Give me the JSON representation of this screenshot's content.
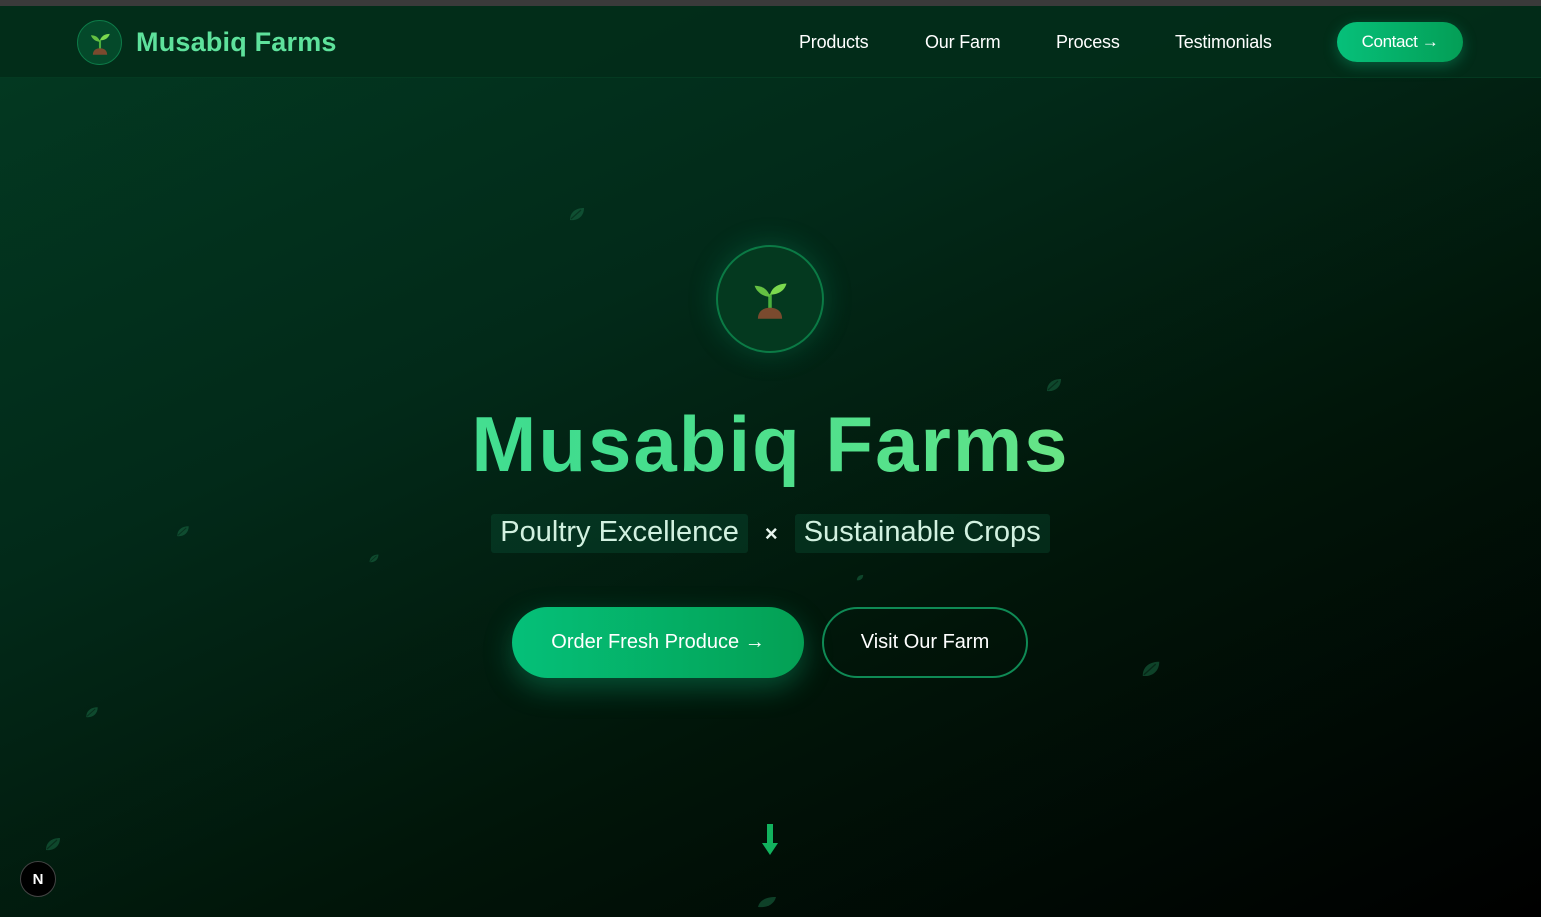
{
  "nav": {
    "brand_name": "Musabiq Farms",
    "logo_icon": "seedling-icon",
    "links": [
      "Products",
      "Our Farm",
      "Process",
      "Testimonials"
    ],
    "contact_label": "Contact →"
  },
  "hero": {
    "icon": "seedling-icon",
    "title": "Musabiq Farms",
    "tag_left": "Poultry Excellence",
    "tag_separator": "×",
    "tag_right": "Sustainable Crops",
    "primary_button": "Order Fresh Produce →",
    "secondary_button": "Visit Our Farm",
    "scroll_icon": "down-arrow-icon"
  },
  "dev_badge": {
    "label": "N"
  },
  "colors": {
    "accent": "#10b981",
    "brand_text": "#5ee29c",
    "background_dark": "#022a19"
  }
}
